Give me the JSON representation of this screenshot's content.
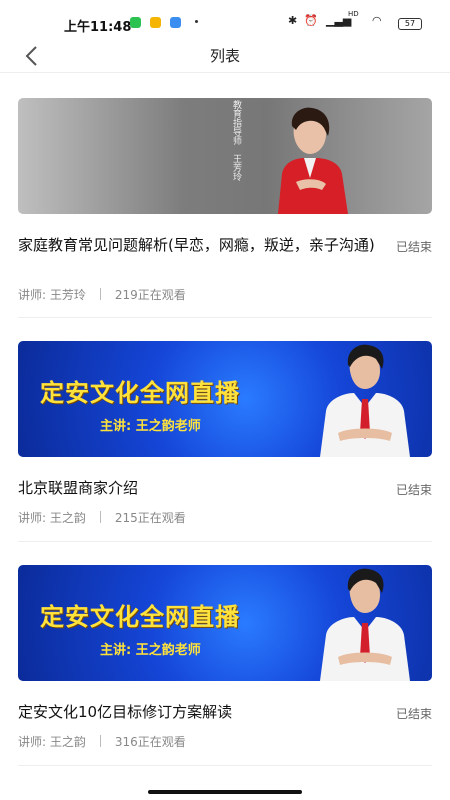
{
  "status_bar": {
    "time": "上午11:48",
    "signal_text": "HD",
    "battery": "57"
  },
  "header": {
    "title": "列表"
  },
  "items": [
    {
      "title": "家庭教育常见问题解析(早恋，网瘾，叛逆，亲子沟通)",
      "status": "已结束",
      "lecturer": "讲师: 王芳玲",
      "viewers": "219正在观看",
      "poster_text_a": "教育指导师",
      "poster_text_b": "王芳玲"
    },
    {
      "title": "北京联盟商家介绍",
      "status": "已结束",
      "lecturer": "讲师: 王之韵",
      "viewers": "215正在观看",
      "banner": "定安文化全网直播",
      "banner_sub": "主讲: 王之韵老师"
    },
    {
      "title": "定安文化10亿目标修订方案解读",
      "status": "已结束",
      "lecturer": "讲师: 王之韵",
      "viewers": "316正在观看",
      "banner": "定安文化全网直播",
      "banner_sub": "主讲: 王之韵老师"
    }
  ]
}
